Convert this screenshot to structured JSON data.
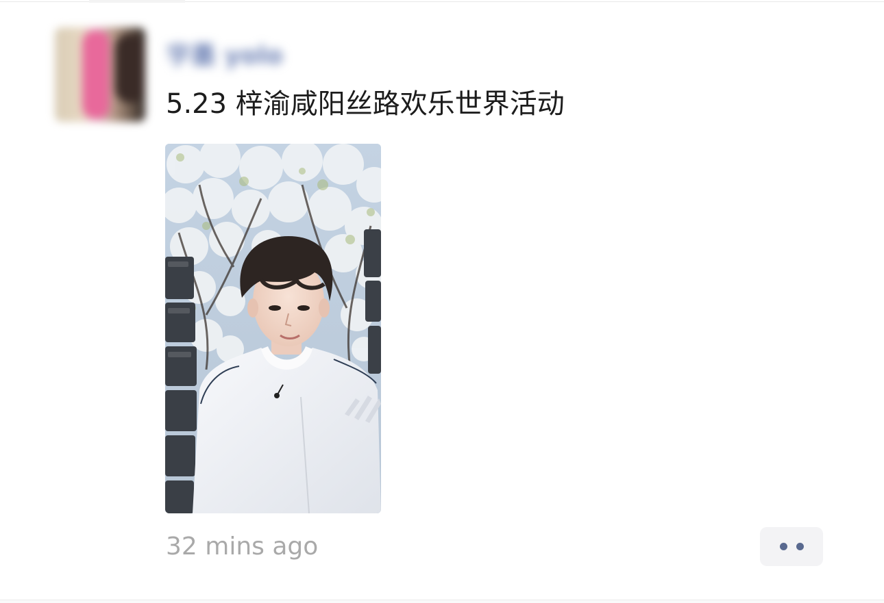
{
  "post": {
    "username": "宇墨 yolo",
    "title": "5.23 梓渝咸阳丝路欢乐世界活动",
    "timestamp": "32 mins ago"
  },
  "colors": {
    "title_text": "#1c1c1c",
    "timestamp_text": "#a9a9a9",
    "username_text": "#6f83b6",
    "more_button_bg": "#f3f3f5",
    "more_button_dots": "#59698f"
  },
  "icons": {
    "more": "more-dots-icon"
  }
}
